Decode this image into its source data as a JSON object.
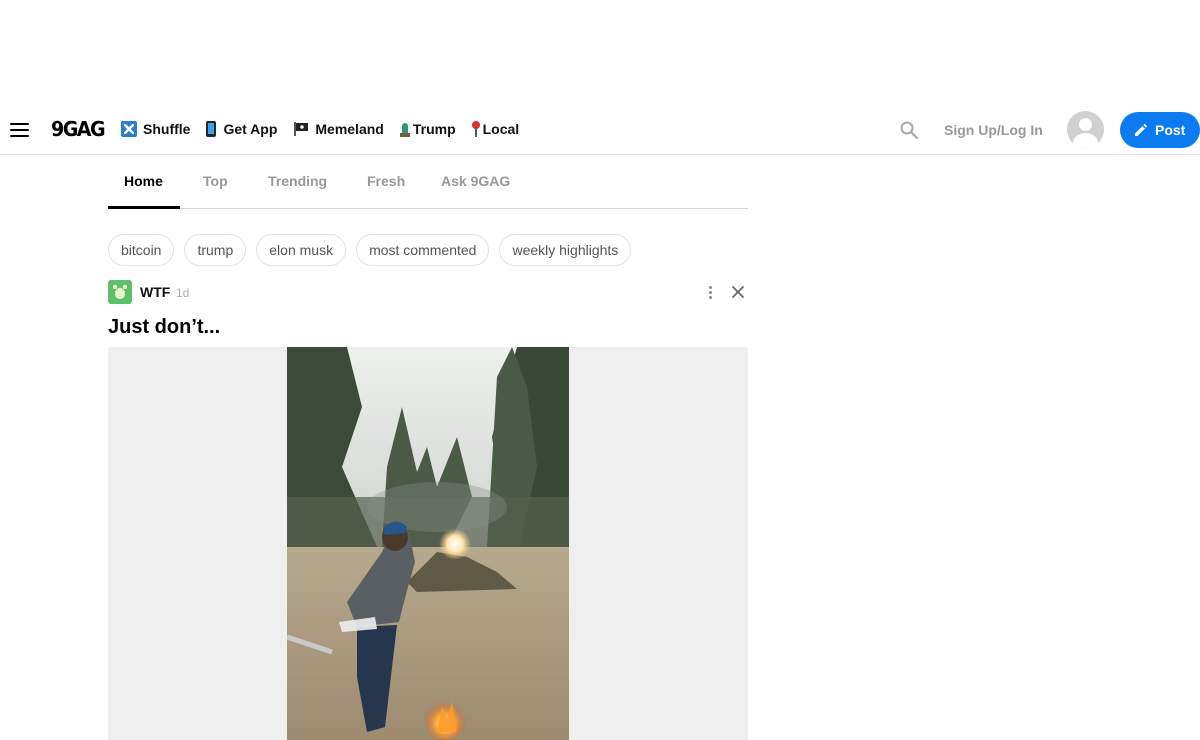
{
  "header": {
    "logo": "9GAG",
    "nav": [
      {
        "label": "Shuffle",
        "icon": "shuffle-icon"
      },
      {
        "label": "Get App",
        "icon": "phone-icon"
      },
      {
        "label": "Memeland",
        "icon": "pirate-flag-icon"
      },
      {
        "label": "Trump",
        "icon": "statue-of-liberty-icon"
      },
      {
        "label": "Local",
        "icon": "pushpin-icon"
      }
    ],
    "signup_label": "Sign Up/Log In",
    "post_label": "Post",
    "accent_color": "#0c7af0"
  },
  "tabs": [
    {
      "label": "Home",
      "active": true
    },
    {
      "label": "Top"
    },
    {
      "label": "Trending"
    },
    {
      "label": "Fresh"
    },
    {
      "label": "Ask 9GAG"
    }
  ],
  "chips": [
    "bitcoin",
    "trump",
    "elon musk",
    "most commented",
    "weekly highlights"
  ],
  "post": {
    "section": "WTF",
    "time": "1d",
    "title": "Just don’t...",
    "media_description": "video"
  }
}
